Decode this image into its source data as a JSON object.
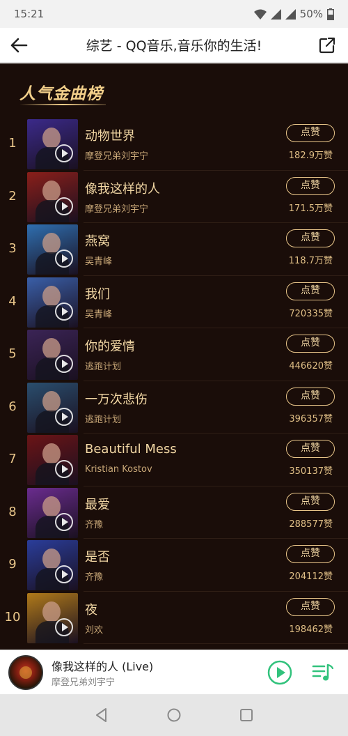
{
  "status_bar": {
    "time": "15:21",
    "battery": "50%"
  },
  "header": {
    "title": "综艺 - QQ音乐,音乐你的生活!"
  },
  "chart": {
    "heading": "人气金曲榜",
    "like_label": "点赞",
    "songs": [
      {
        "rank": "1",
        "title": "动物世界",
        "artist": "摩登兄弟刘宇宁",
        "likes": "182.9万赞",
        "cover_color": "#3b2a8a"
      },
      {
        "rank": "2",
        "title": "像我这样的人",
        "artist": "摩登兄弟刘宇宁",
        "likes": "171.5万赞",
        "cover_color": "#8a1f1a"
      },
      {
        "rank": "3",
        "title": "燕窝",
        "artist": "吴青峰",
        "likes": "118.7万赞",
        "cover_color": "#2f6fb0"
      },
      {
        "rank": "4",
        "title": "我们",
        "artist": "吴青峰",
        "likes": "720335赞",
        "cover_color": "#3a5fa8"
      },
      {
        "rank": "5",
        "title": "你的爱情",
        "artist": "逃跑计划",
        "likes": "446620赞",
        "cover_color": "#3b2456"
      },
      {
        "rank": "6",
        "title": "一万次悲伤",
        "artist": "逃跑计划",
        "likes": "396357赞",
        "cover_color": "#2a4e6e"
      },
      {
        "rank": "7",
        "title": "Beautiful Mess",
        "artist": "Kristian Kostov",
        "likes": "350137赞",
        "cover_color": "#6b1416"
      },
      {
        "rank": "8",
        "title": "最爱",
        "artist": "齐豫",
        "likes": "288577赞",
        "cover_color": "#6a2c8e"
      },
      {
        "rank": "9",
        "title": "是否",
        "artist": "齐豫",
        "likes": "204112赞",
        "cover_color": "#2a3d9a"
      },
      {
        "rank": "10",
        "title": "夜",
        "artist": "刘欢",
        "likes": "198462赞",
        "cover_color": "#b07a1a"
      }
    ]
  },
  "player": {
    "title": "像我这样的人 (Live)",
    "artist": "摩登兄弟刘宇宁",
    "accent": "#31c27c"
  }
}
